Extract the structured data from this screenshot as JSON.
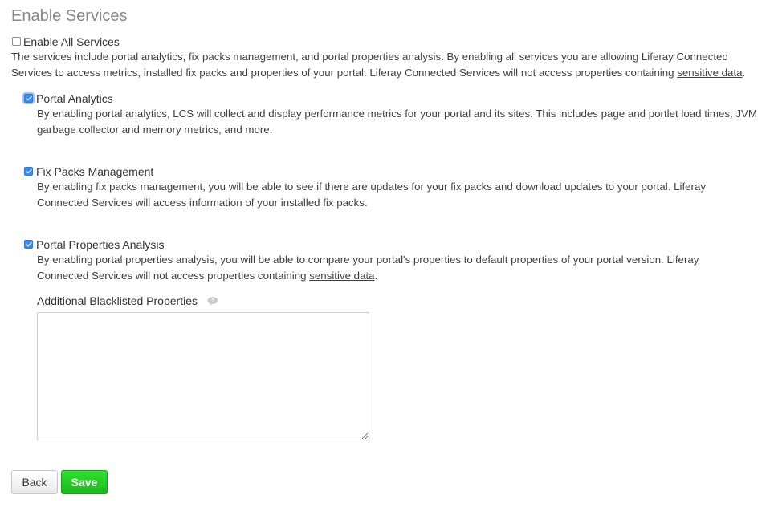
{
  "page": {
    "title": "Enable Services"
  },
  "enable_all": {
    "label": "Enable All Services",
    "checked": false,
    "desc_prefix": "The services include portal analytics, fix packs management, and portal properties analysis. By enabling all services you are allowing Liferay Connected Services to access metrics, installed fix packs and properties of your portal. Liferay Connected Services will not access properties containing ",
    "desc_link": "sensitive data",
    "desc_suffix": "."
  },
  "services": {
    "portal_analytics": {
      "label": "Portal Analytics",
      "checked": true,
      "description": "By enabling portal analytics, LCS will collect and display performance metrics for your portal and its sites. This includes page and portlet load times, JVM garbage collector and memory metrics, and more."
    },
    "fix_packs": {
      "label": "Fix Packs Management",
      "checked": true,
      "description": "By enabling fix packs management, you will be able to see if there are updates for your fix packs and download updates to your portal. Liferay Connected Services will access information of your installed fix packs."
    },
    "portal_properties": {
      "label": "Portal Properties Analysis",
      "checked": true,
      "desc_prefix": "By enabling portal properties analysis, you will be able to compare your portal's properties to default properties of your portal version. Liferay Connected Services will not access properties containing ",
      "desc_link": "sensitive data",
      "desc_suffix": "."
    }
  },
  "blacklist": {
    "label": "Additional Blacklisted Properties",
    "value": "",
    "help_icon": "speech-bubble-help-icon"
  },
  "actions": {
    "back_label": "Back",
    "save_label": "Save"
  },
  "colors": {
    "title": "#888888",
    "save_button": "#2ed02e",
    "checkbox_checked": "#3a8bf4"
  }
}
